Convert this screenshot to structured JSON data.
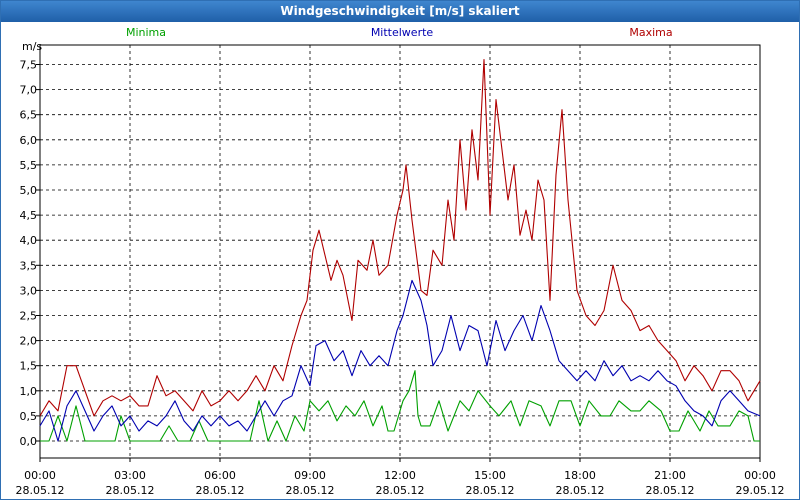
{
  "window": {
    "title": "Windgeschwindigkeit [m/s] skaliert"
  },
  "chart_data": {
    "type": "line",
    "title": "Windgeschwindigkeit [m/s] skaliert",
    "ylabel": "m/s",
    "ylim": [
      0,
      7.8
    ],
    "xlim": [
      0,
      24
    ],
    "yticks": [
      {
        "v": 0,
        "label": "0,0"
      },
      {
        "v": 0.5,
        "label": "0,5"
      },
      {
        "v": 1,
        "label": "1,0"
      },
      {
        "v": 1.5,
        "label": "1,5"
      },
      {
        "v": 2,
        "label": "2,0"
      },
      {
        "v": 2.5,
        "label": "2,5"
      },
      {
        "v": 3,
        "label": "3,0"
      },
      {
        "v": 3.5,
        "label": "3,5"
      },
      {
        "v": 4,
        "label": "4,0"
      },
      {
        "v": 4.5,
        "label": "4,5"
      },
      {
        "v": 5,
        "label": "5,0"
      },
      {
        "v": 5.5,
        "label": "5,5"
      },
      {
        "v": 6,
        "label": "6,0"
      },
      {
        "v": 6.5,
        "label": "6,5"
      },
      {
        "v": 7,
        "label": "7,0"
      },
      {
        "v": 7.5,
        "label": "7,5"
      }
    ],
    "xticks": [
      {
        "h": 0,
        "time": "00:00",
        "date": "28.05.12"
      },
      {
        "h": 3,
        "time": "03:00",
        "date": "28.05.12"
      },
      {
        "h": 6,
        "time": "06:00",
        "date": "28.05.12"
      },
      {
        "h": 9,
        "time": "09:00",
        "date": "28.05.12"
      },
      {
        "h": 12,
        "time": "12:00",
        "date": "28.05.12"
      },
      {
        "h": 15,
        "time": "15:00",
        "date": "28.05.12"
      },
      {
        "h": 18,
        "time": "18:00",
        "date": "28.05.12"
      },
      {
        "h": 21,
        "time": "21:00",
        "date": "28.05.12"
      },
      {
        "h": 24,
        "time": "00:00",
        "date": "29.05.12"
      }
    ],
    "grid": true,
    "legend_position": "top",
    "series": [
      {
        "name": "Minima",
        "color": "#00a000",
        "points": [
          [
            0,
            0
          ],
          [
            0.3,
            0
          ],
          [
            0.6,
            0.5
          ],
          [
            0.9,
            0
          ],
          [
            1.2,
            0.7
          ],
          [
            1.5,
            0
          ],
          [
            2.0,
            0
          ],
          [
            2.5,
            0
          ],
          [
            2.7,
            0.5
          ],
          [
            3.0,
            0
          ],
          [
            3.5,
            0
          ],
          [
            4.0,
            0
          ],
          [
            4.3,
            0.3
          ],
          [
            4.6,
            0
          ],
          [
            5.0,
            0
          ],
          [
            5.3,
            0.4
          ],
          [
            5.6,
            0
          ],
          [
            6.0,
            0
          ],
          [
            6.5,
            0
          ],
          [
            7.0,
            0
          ],
          [
            7.3,
            0.8
          ],
          [
            7.6,
            0
          ],
          [
            7.9,
            0.4
          ],
          [
            8.2,
            0
          ],
          [
            8.5,
            0.5
          ],
          [
            8.8,
            0.2
          ],
          [
            9.0,
            0.8
          ],
          [
            9.3,
            0.6
          ],
          [
            9.6,
            0.8
          ],
          [
            9.9,
            0.4
          ],
          [
            10.2,
            0.7
          ],
          [
            10.5,
            0.5
          ],
          [
            10.8,
            0.8
          ],
          [
            11.1,
            0.3
          ],
          [
            11.4,
            0.7
          ],
          [
            11.6,
            0.2
          ],
          [
            11.8,
            0.2
          ],
          [
            12.1,
            0.8
          ],
          [
            12.3,
            1.0
          ],
          [
            12.5,
            1.4
          ],
          [
            12.6,
            0.5
          ],
          [
            12.7,
            0.3
          ],
          [
            13.0,
            0.3
          ],
          [
            13.3,
            0.8
          ],
          [
            13.6,
            0.2
          ],
          [
            14.0,
            0.8
          ],
          [
            14.3,
            0.6
          ],
          [
            14.6,
            1.0
          ],
          [
            15.0,
            0.7
          ],
          [
            15.3,
            0.5
          ],
          [
            15.7,
            0.8
          ],
          [
            16.0,
            0.3
          ],
          [
            16.3,
            0.8
          ],
          [
            16.7,
            0.7
          ],
          [
            17.0,
            0.3
          ],
          [
            17.3,
            0.8
          ],
          [
            17.7,
            0.8
          ],
          [
            18.0,
            0.3
          ],
          [
            18.3,
            0.8
          ],
          [
            18.7,
            0.5
          ],
          [
            19.0,
            0.5
          ],
          [
            19.3,
            0.8
          ],
          [
            19.7,
            0.6
          ],
          [
            20.0,
            0.6
          ],
          [
            20.3,
            0.8
          ],
          [
            20.7,
            0.6
          ],
          [
            21.0,
            0.2
          ],
          [
            21.3,
            0.2
          ],
          [
            21.6,
            0.6
          ],
          [
            22.0,
            0.2
          ],
          [
            22.3,
            0.6
          ],
          [
            22.6,
            0.3
          ],
          [
            23.0,
            0.3
          ],
          [
            23.3,
            0.6
          ],
          [
            23.6,
            0.5
          ],
          [
            23.8,
            0
          ],
          [
            24.0,
            0
          ]
        ]
      },
      {
        "name": "Mittelwerte",
        "color": "#0000b0",
        "points": [
          [
            0,
            0.3
          ],
          [
            0.3,
            0.6
          ],
          [
            0.6,
            0
          ],
          [
            0.9,
            0.7
          ],
          [
            1.2,
            1.0
          ],
          [
            1.5,
            0.6
          ],
          [
            1.8,
            0.2
          ],
          [
            2.1,
            0.5
          ],
          [
            2.4,
            0.7
          ],
          [
            2.7,
            0.3
          ],
          [
            3.0,
            0.5
          ],
          [
            3.3,
            0.2
          ],
          [
            3.6,
            0.4
          ],
          [
            3.9,
            0.3
          ],
          [
            4.2,
            0.5
          ],
          [
            4.5,
            0.8
          ],
          [
            4.8,
            0.4
          ],
          [
            5.1,
            0.2
          ],
          [
            5.4,
            0.5
          ],
          [
            5.7,
            0.3
          ],
          [
            6.0,
            0.5
          ],
          [
            6.3,
            0.3
          ],
          [
            6.6,
            0.4
          ],
          [
            6.9,
            0.2
          ],
          [
            7.2,
            0.5
          ],
          [
            7.5,
            0.8
          ],
          [
            7.8,
            0.5
          ],
          [
            8.1,
            0.8
          ],
          [
            8.4,
            0.9
          ],
          [
            8.7,
            1.5
          ],
          [
            9.0,
            1.1
          ],
          [
            9.2,
            1.9
          ],
          [
            9.5,
            2.0
          ],
          [
            9.8,
            1.6
          ],
          [
            10.1,
            1.8
          ],
          [
            10.4,
            1.3
          ],
          [
            10.7,
            1.8
          ],
          [
            11.0,
            1.5
          ],
          [
            11.3,
            1.7
          ],
          [
            11.6,
            1.5
          ],
          [
            11.9,
            2.2
          ],
          [
            12.1,
            2.5
          ],
          [
            12.4,
            3.2
          ],
          [
            12.7,
            2.8
          ],
          [
            12.9,
            2.3
          ],
          [
            13.1,
            1.5
          ],
          [
            13.4,
            1.8
          ],
          [
            13.7,
            2.5
          ],
          [
            14.0,
            1.8
          ],
          [
            14.3,
            2.3
          ],
          [
            14.6,
            2.2
          ],
          [
            14.9,
            1.5
          ],
          [
            15.2,
            2.4
          ],
          [
            15.5,
            1.8
          ],
          [
            15.8,
            2.2
          ],
          [
            16.1,
            2.5
          ],
          [
            16.4,
            2.0
          ],
          [
            16.7,
            2.7
          ],
          [
            17.0,
            2.2
          ],
          [
            17.3,
            1.6
          ],
          [
            17.6,
            1.4
          ],
          [
            17.9,
            1.2
          ],
          [
            18.2,
            1.4
          ],
          [
            18.5,
            1.2
          ],
          [
            18.8,
            1.6
          ],
          [
            19.1,
            1.3
          ],
          [
            19.4,
            1.5
          ],
          [
            19.7,
            1.2
          ],
          [
            20.0,
            1.3
          ],
          [
            20.3,
            1.2
          ],
          [
            20.6,
            1.4
          ],
          [
            20.9,
            1.2
          ],
          [
            21.2,
            1.1
          ],
          [
            21.5,
            0.8
          ],
          [
            21.8,
            0.6
          ],
          [
            22.1,
            0.5
          ],
          [
            22.4,
            0.3
          ],
          [
            22.7,
            0.8
          ],
          [
            23.0,
            1.0
          ],
          [
            23.3,
            0.8
          ],
          [
            23.6,
            0.6
          ],
          [
            24.0,
            0.5
          ]
        ]
      },
      {
        "name": "Maxima",
        "color": "#b00000",
        "points": [
          [
            0,
            0.5
          ],
          [
            0.3,
            0.8
          ],
          [
            0.6,
            0.6
          ],
          [
            0.9,
            1.5
          ],
          [
            1.2,
            1.5
          ],
          [
            1.5,
            1.0
          ],
          [
            1.8,
            0.5
          ],
          [
            2.1,
            0.8
          ],
          [
            2.4,
            0.9
          ],
          [
            2.7,
            0.8
          ],
          [
            3.0,
            0.9
          ],
          [
            3.3,
            0.7
          ],
          [
            3.6,
            0.7
          ],
          [
            3.9,
            1.3
          ],
          [
            4.2,
            0.9
          ],
          [
            4.5,
            1.0
          ],
          [
            4.8,
            0.8
          ],
          [
            5.1,
            0.6
          ],
          [
            5.4,
            1.0
          ],
          [
            5.7,
            0.7
          ],
          [
            6.0,
            0.8
          ],
          [
            6.3,
            1.0
          ],
          [
            6.6,
            0.8
          ],
          [
            6.9,
            1.0
          ],
          [
            7.2,
            1.3
          ],
          [
            7.5,
            1.0
          ],
          [
            7.8,
            1.5
          ],
          [
            8.1,
            1.2
          ],
          [
            8.4,
            1.9
          ],
          [
            8.7,
            2.5
          ],
          [
            8.9,
            2.8
          ],
          [
            9.1,
            3.8
          ],
          [
            9.3,
            4.2
          ],
          [
            9.5,
            3.7
          ],
          [
            9.7,
            3.2
          ],
          [
            9.9,
            3.6
          ],
          [
            10.1,
            3.3
          ],
          [
            10.4,
            2.4
          ],
          [
            10.6,
            3.6
          ],
          [
            10.9,
            3.4
          ],
          [
            11.1,
            4.0
          ],
          [
            11.3,
            3.3
          ],
          [
            11.6,
            3.5
          ],
          [
            11.9,
            4.5
          ],
          [
            12.1,
            5.0
          ],
          [
            12.2,
            5.5
          ],
          [
            12.4,
            4.4
          ],
          [
            12.7,
            3.0
          ],
          [
            12.9,
            2.9
          ],
          [
            13.1,
            3.8
          ],
          [
            13.4,
            3.5
          ],
          [
            13.6,
            4.8
          ],
          [
            13.8,
            4.0
          ],
          [
            14.0,
            6.0
          ],
          [
            14.2,
            4.6
          ],
          [
            14.4,
            6.2
          ],
          [
            14.6,
            5.2
          ],
          [
            14.8,
            7.6
          ],
          [
            15.0,
            4.5
          ],
          [
            15.2,
            6.8
          ],
          [
            15.4,
            5.8
          ],
          [
            15.6,
            4.8
          ],
          [
            15.8,
            5.5
          ],
          [
            16.0,
            4.1
          ],
          [
            16.2,
            4.6
          ],
          [
            16.4,
            4.0
          ],
          [
            16.6,
            5.2
          ],
          [
            16.8,
            4.8
          ],
          [
            17.0,
            2.8
          ],
          [
            17.2,
            5.3
          ],
          [
            17.4,
            6.6
          ],
          [
            17.6,
            4.8
          ],
          [
            17.9,
            3.0
          ],
          [
            18.2,
            2.5
          ],
          [
            18.5,
            2.3
          ],
          [
            18.8,
            2.6
          ],
          [
            19.1,
            3.5
          ],
          [
            19.4,
            2.8
          ],
          [
            19.7,
            2.6
          ],
          [
            20.0,
            2.2
          ],
          [
            20.3,
            2.3
          ],
          [
            20.6,
            2.0
          ],
          [
            20.9,
            1.8
          ],
          [
            21.2,
            1.6
          ],
          [
            21.5,
            1.2
          ],
          [
            21.8,
            1.5
          ],
          [
            22.1,
            1.3
          ],
          [
            22.4,
            1.0
          ],
          [
            22.7,
            1.4
          ],
          [
            23.0,
            1.4
          ],
          [
            23.3,
            1.2
          ],
          [
            23.6,
            0.8
          ],
          [
            24.0,
            1.2
          ]
        ]
      }
    ]
  }
}
